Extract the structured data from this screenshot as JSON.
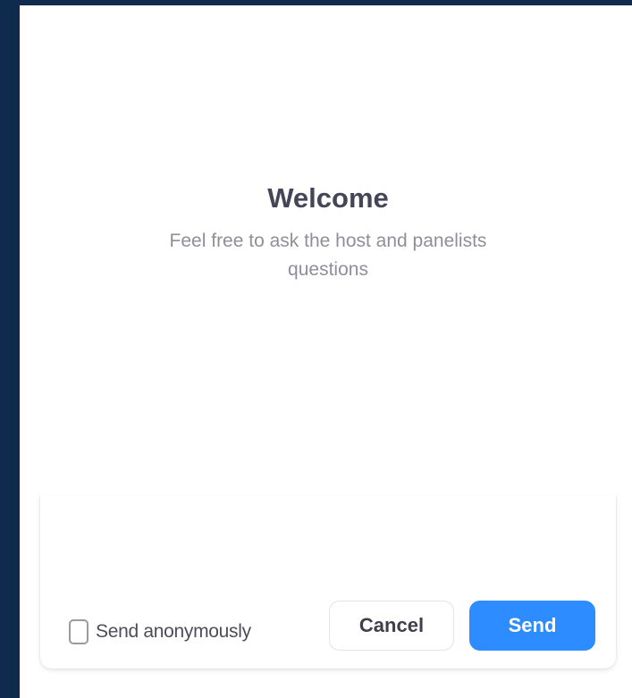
{
  "welcome": {
    "title": "Welcome",
    "subtitle": "Feel free to ask the host and panelists questions"
  },
  "composer": {
    "value": "",
    "anonymous_label": "Send anonymously",
    "anonymous_checked": false,
    "cancel_label": "Cancel",
    "send_label": "Send"
  },
  "colors": {
    "background": "#0f2a4d",
    "send_button": "#2d8cff"
  }
}
